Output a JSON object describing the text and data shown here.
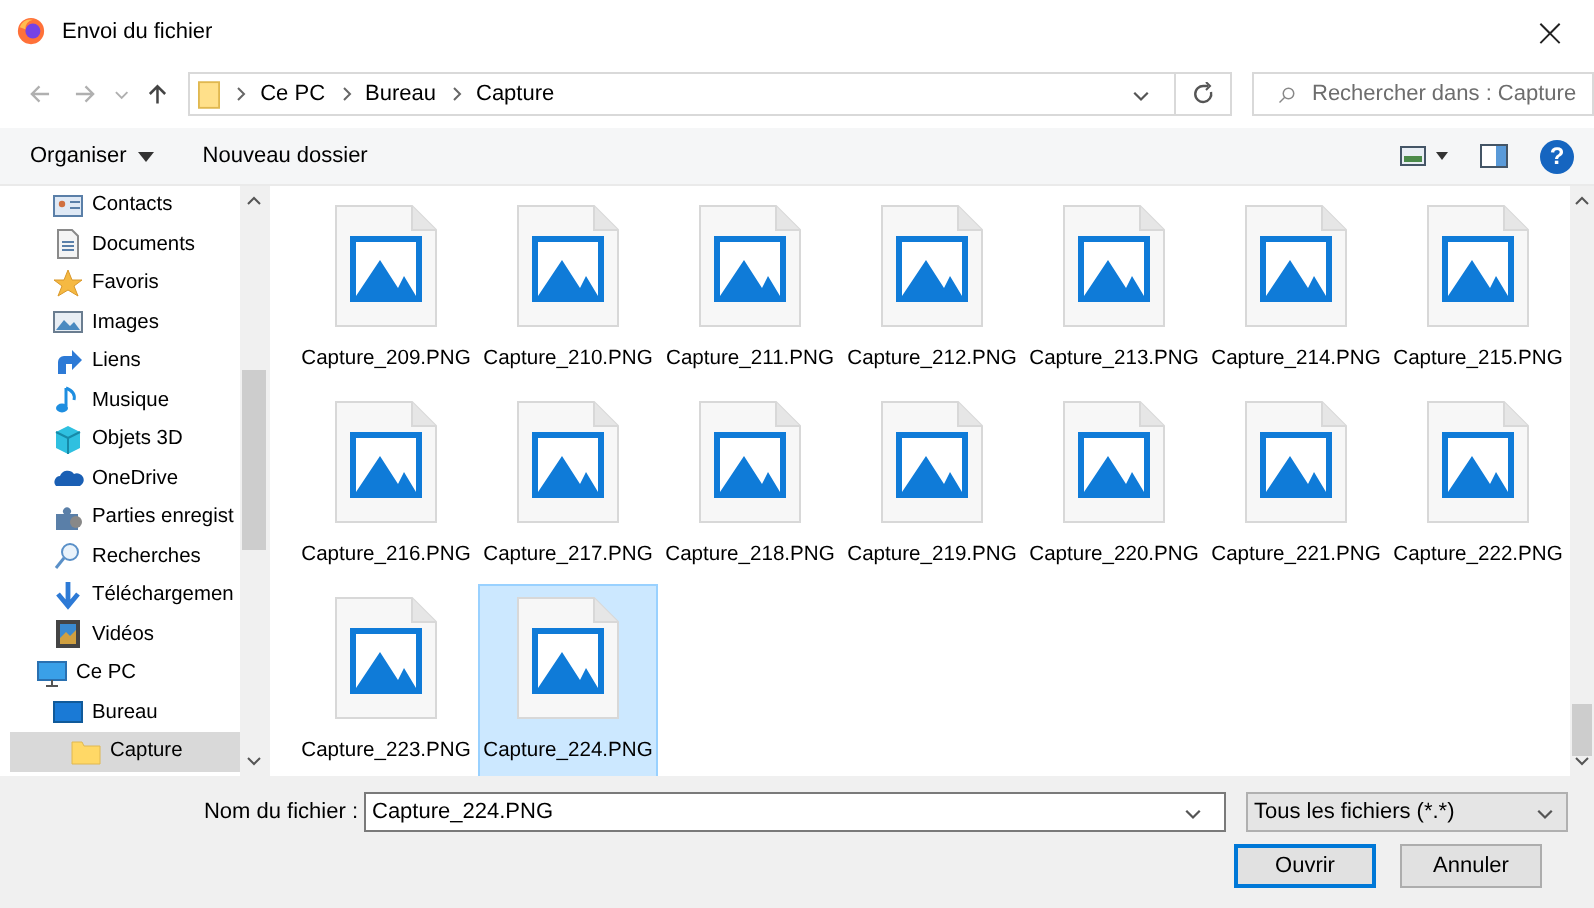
{
  "window": {
    "title": "Envoi du fichier",
    "close": "×"
  },
  "address": {
    "path": [
      {
        "label": "Ce PC"
      },
      {
        "label": "Bureau"
      },
      {
        "label": "Capture"
      }
    ]
  },
  "search": {
    "placeholder": "Rechercher dans : Capture"
  },
  "toolbar": {
    "organize": "Organiser",
    "new_folder": "Nouveau dossier",
    "help": "?"
  },
  "sidebar": {
    "items": [
      {
        "label": "Contacts",
        "kind": "contacts",
        "selected": false
      },
      {
        "label": "Documents",
        "kind": "documents",
        "selected": false
      },
      {
        "label": "Favoris",
        "kind": "star",
        "selected": false
      },
      {
        "label": "Images",
        "kind": "images",
        "selected": false
      },
      {
        "label": "Liens",
        "kind": "link",
        "selected": false
      },
      {
        "label": "Musique",
        "kind": "music",
        "selected": false
      },
      {
        "label": "Objets 3D",
        "kind": "cube",
        "selected": false
      },
      {
        "label": "OneDrive",
        "kind": "cloud",
        "selected": false
      },
      {
        "label": "Parties enregist",
        "kind": "puzzle",
        "selected": false
      },
      {
        "label": "Recherches",
        "kind": "search",
        "selected": false
      },
      {
        "label": "Téléchargemen",
        "kind": "download",
        "selected": false
      },
      {
        "label": "Vidéos",
        "kind": "video",
        "selected": false
      }
    ],
    "tree": [
      {
        "label": "Ce PC",
        "kind": "pc",
        "selected": false,
        "children": [
          {
            "label": "Bureau",
            "kind": "desktop",
            "selected": false,
            "children": [
              {
                "label": "Capture",
                "kind": "folder",
                "selected": true
              }
            ]
          }
        ]
      }
    ]
  },
  "files": [
    {
      "name": "Capture_209.PNG",
      "selected": false
    },
    {
      "name": "Capture_210.PNG",
      "selected": false
    },
    {
      "name": "Capture_211.PNG",
      "selected": false
    },
    {
      "name": "Capture_212.PNG",
      "selected": false
    },
    {
      "name": "Capture_213.PNG",
      "selected": false
    },
    {
      "name": "Capture_214.PNG",
      "selected": false
    },
    {
      "name": "Capture_215.PNG",
      "selected": false
    },
    {
      "name": "Capture_216.PNG",
      "selected": false
    },
    {
      "name": "Capture_217.PNG",
      "selected": false
    },
    {
      "name": "Capture_218.PNG",
      "selected": false
    },
    {
      "name": "Capture_219.PNG",
      "selected": false
    },
    {
      "name": "Capture_220.PNG",
      "selected": false
    },
    {
      "name": "Capture_221.PNG",
      "selected": false
    },
    {
      "name": "Capture_222.PNG",
      "selected": false
    },
    {
      "name": "Capture_223.PNG",
      "selected": false
    },
    {
      "name": "Capture_224.PNG",
      "selected": true
    }
  ],
  "footer": {
    "filename_label": "Nom du fichier :",
    "filename": "Capture_224.PNG",
    "filter": "Tous les fichiers (*.*)",
    "buttons": [
      {
        "label": "Ouvrir",
        "kind": "default"
      },
      {
        "label": "Annuler",
        "kind": "normal"
      }
    ]
  }
}
